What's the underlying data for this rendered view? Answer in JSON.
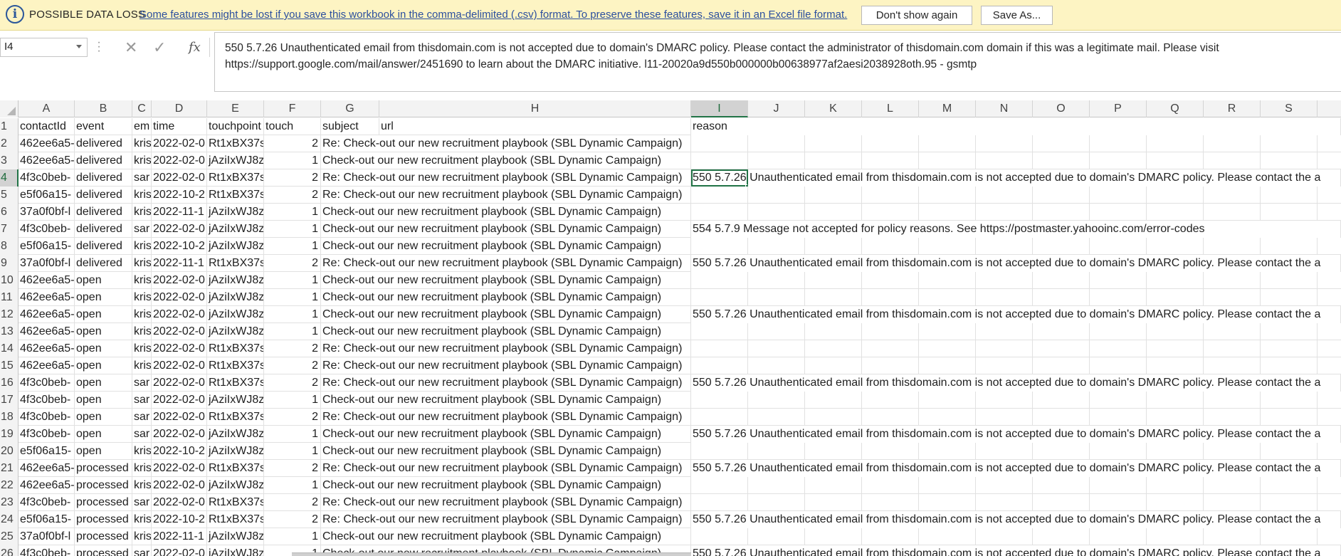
{
  "message_bar": {
    "title": "POSSIBLE DATA LOSS",
    "message": "Some features might be lost if you save this workbook in the comma-delimited (.csv) format. To preserve these features, save it in an Excel file format.",
    "dont_show_label": "Don't show again",
    "save_as_label": "Save As..."
  },
  "formula_bar": {
    "name_box": "I4",
    "cancel_glyph": "✕",
    "enter_glyph": "✓",
    "fx_label": "fx",
    "content": "550 5.7.26 Unauthenticated email from thisdomain.com is not accepted due to domain's DMARC policy. Please contact the administrator of thisdomain.com domain if this was a legitimate mail. Please visit https://support.google.com/mail/answer/2451690 to learn about the DMARC initiative. l11-20020a9d550b000000b00638977af2aesi2038928oth.95 - gsmtp"
  },
  "columns": [
    "A",
    "B",
    "C",
    "D",
    "E",
    "F",
    "G",
    "H",
    "I",
    "J",
    "K",
    "L",
    "M",
    "N",
    "O",
    "P",
    "Q",
    "R",
    "S"
  ],
  "active_column": "I",
  "active_row": "4",
  "header_row": {
    "num": "1",
    "contactId": "contactId",
    "event": "event",
    "email": "em",
    "time": "time",
    "touchpoint": "touchpoint",
    "touch": "touch",
    "subject": "subject",
    "url": "url",
    "reason": "reason"
  },
  "rows": [
    {
      "num": "2",
      "contactId": "462ee6a5-",
      "event": "delivered",
      "email": "kris",
      "time": "2022-02-0",
      "touchpoint": "Rt1xBX37s",
      "touch": "2",
      "subject": "Re: Check-out our new recruitment playbook (SBL Dynamic Campaign)",
      "reason": ""
    },
    {
      "num": "3",
      "contactId": "462ee6a5-",
      "event": "delivered",
      "email": "kris",
      "time": "2022-02-0",
      "touchpoint": "jAziIxWJ8z",
      "touch": "1",
      "subject": "Check-out our new recruitment playbook (SBL Dynamic Campaign)",
      "reason": ""
    },
    {
      "num": "4",
      "contactId": "4f3c0beb-",
      "event": "delivered",
      "email": "sar",
      "time": "2022-02-0",
      "touchpoint": "Rt1xBX37s",
      "touch": "2",
      "subject": "Re: Check-out our new recruitment playbook (SBL Dynamic Campaign)",
      "reason": "550 5.7.26 Unauthenticated email from thisdomain.com is not accepted due to domain's DMARC policy. Please contact the a"
    },
    {
      "num": "5",
      "contactId": "e5f06a15-",
      "event": "delivered",
      "email": "kris",
      "time": "2022-10-2",
      "touchpoint": "Rt1xBX37s",
      "touch": "2",
      "subject": "Re: Check-out our new recruitment playbook (SBL Dynamic Campaign)",
      "reason": ""
    },
    {
      "num": "6",
      "contactId": "37a0f0bf-l",
      "event": "delivered",
      "email": "kris",
      "time": "2022-11-1",
      "touchpoint": "jAziIxWJ8z",
      "touch": "1",
      "subject": "Check-out our new recruitment playbook (SBL Dynamic Campaign)",
      "reason": ""
    },
    {
      "num": "7",
      "contactId": "4f3c0beb-",
      "event": "delivered",
      "email": "sar",
      "time": "2022-02-0",
      "touchpoint": "jAziIxWJ8z",
      "touch": "1",
      "subject": "Check-out our new recruitment playbook (SBL Dynamic Campaign)",
      "reason": "554 5.7.9 Message not accepted for policy reasons. See https://postmaster.yahooinc.com/error-codes"
    },
    {
      "num": "8",
      "contactId": "e5f06a15-",
      "event": "delivered",
      "email": "kris",
      "time": "2022-10-2",
      "touchpoint": "jAziIxWJ8z",
      "touch": "1",
      "subject": "Check-out our new recruitment playbook (SBL Dynamic Campaign)",
      "reason": ""
    },
    {
      "num": "9",
      "contactId": "37a0f0bf-l",
      "event": "delivered",
      "email": "kris",
      "time": "2022-11-1",
      "touchpoint": "Rt1xBX37s",
      "touch": "2",
      "subject": "Re: Check-out our new recruitment playbook (SBL Dynamic Campaign)",
      "reason": "550 5.7.26 Unauthenticated email from thisdomain.com is not accepted due to domain's DMARC policy. Please contact the a"
    },
    {
      "num": "10",
      "contactId": "462ee6a5-",
      "event": "open",
      "email": "kris",
      "time": "2022-02-0",
      "touchpoint": "jAziIxWJ8z",
      "touch": "1",
      "subject": "Check-out our new recruitment playbook (SBL Dynamic Campaign)",
      "reason": ""
    },
    {
      "num": "11",
      "contactId": "462ee6a5-",
      "event": "open",
      "email": "kris",
      "time": "2022-02-0",
      "touchpoint": "jAziIxWJ8z",
      "touch": "1",
      "subject": "Check-out our new recruitment playbook (SBL Dynamic Campaign)",
      "reason": ""
    },
    {
      "num": "12",
      "contactId": "462ee6a5-",
      "event": "open",
      "email": "kris",
      "time": "2022-02-0",
      "touchpoint": "jAziIxWJ8z",
      "touch": "1",
      "subject": "Check-out our new recruitment playbook (SBL Dynamic Campaign)",
      "reason": "550 5.7.26 Unauthenticated email from thisdomain.com is not accepted due to domain's DMARC policy. Please contact the a"
    },
    {
      "num": "13",
      "contactId": "462ee6a5-",
      "event": "open",
      "email": "kris",
      "time": "2022-02-0",
      "touchpoint": "jAziIxWJ8z",
      "touch": "1",
      "subject": "Check-out our new recruitment playbook (SBL Dynamic Campaign)",
      "reason": ""
    },
    {
      "num": "14",
      "contactId": "462ee6a5-",
      "event": "open",
      "email": "kris",
      "time": "2022-02-0",
      "touchpoint": "Rt1xBX37s",
      "touch": "2",
      "subject": "Re: Check-out our new recruitment playbook (SBL Dynamic Campaign)",
      "reason": ""
    },
    {
      "num": "15",
      "contactId": "462ee6a5-",
      "event": "open",
      "email": "kris",
      "time": "2022-02-0",
      "touchpoint": "Rt1xBX37s",
      "touch": "2",
      "subject": "Re: Check-out our new recruitment playbook (SBL Dynamic Campaign)",
      "reason": ""
    },
    {
      "num": "16",
      "contactId": "4f3c0beb-",
      "event": "open",
      "email": "sar",
      "time": "2022-02-0",
      "touchpoint": "Rt1xBX37s",
      "touch": "2",
      "subject": "Re: Check-out our new recruitment playbook (SBL Dynamic Campaign)",
      "reason": "550 5.7.26 Unauthenticated email from thisdomain.com is not accepted due to domain's DMARC policy. Please contact the a"
    },
    {
      "num": "17",
      "contactId": "4f3c0beb-",
      "event": "open",
      "email": "sar",
      "time": "2022-02-0",
      "touchpoint": "jAziIxWJ8z",
      "touch": "1",
      "subject": "Check-out our new recruitment playbook (SBL Dynamic Campaign)",
      "reason": ""
    },
    {
      "num": "18",
      "contactId": "4f3c0beb-",
      "event": "open",
      "email": "sar",
      "time": "2022-02-0",
      "touchpoint": "Rt1xBX37s",
      "touch": "2",
      "subject": "Re: Check-out our new recruitment playbook (SBL Dynamic Campaign)",
      "reason": ""
    },
    {
      "num": "19",
      "contactId": "4f3c0beb-",
      "event": "open",
      "email": "sar",
      "time": "2022-02-0",
      "touchpoint": "jAziIxWJ8z",
      "touch": "1",
      "subject": "Check-out our new recruitment playbook (SBL Dynamic Campaign)",
      "reason": "550 5.7.26 Unauthenticated email from thisdomain.com is not accepted due to domain's DMARC policy. Please contact the a"
    },
    {
      "num": "20",
      "contactId": "e5f06a15-",
      "event": "open",
      "email": "kris",
      "time": "2022-10-2",
      "touchpoint": "jAziIxWJ8z",
      "touch": "1",
      "subject": "Check-out our new recruitment playbook (SBL Dynamic Campaign)",
      "reason": ""
    },
    {
      "num": "21",
      "contactId": "462ee6a5-",
      "event": "processed",
      "email": "kris",
      "time": "2022-02-0",
      "touchpoint": "Rt1xBX37s",
      "touch": "2",
      "subject": "Re: Check-out our new recruitment playbook (SBL Dynamic Campaign)",
      "reason": "550 5.7.26 Unauthenticated email from thisdomain.com is not accepted due to domain's DMARC policy. Please contact the a"
    },
    {
      "num": "22",
      "contactId": "462ee6a5-",
      "event": "processed",
      "email": "kris",
      "time": "2022-02-0",
      "touchpoint": "jAziIxWJ8z",
      "touch": "1",
      "subject": "Check-out our new recruitment playbook (SBL Dynamic Campaign)",
      "reason": ""
    },
    {
      "num": "23",
      "contactId": "4f3c0beb-",
      "event": "processed",
      "email": "sar",
      "time": "2022-02-0",
      "touchpoint": "Rt1xBX37s",
      "touch": "2",
      "subject": "Re: Check-out our new recruitment playbook (SBL Dynamic Campaign)",
      "reason": ""
    },
    {
      "num": "24",
      "contactId": "e5f06a15-",
      "event": "processed",
      "email": "kris",
      "time": "2022-10-2",
      "touchpoint": "Rt1xBX37s",
      "touch": "2",
      "subject": "Re: Check-out our new recruitment playbook (SBL Dynamic Campaign)",
      "reason": "550 5.7.26 Unauthenticated email from thisdomain.com is not accepted due to domain's DMARC policy. Please contact the a"
    },
    {
      "num": "25",
      "contactId": "37a0f0bf-l",
      "event": "processed",
      "email": "kris",
      "time": "2022-11-1",
      "touchpoint": "jAziIxWJ8z",
      "touch": "1",
      "subject": "Check-out our new recruitment playbook (SBL Dynamic Campaign)",
      "reason": ""
    },
    {
      "num": "26",
      "contactId": "4f3c0beb-",
      "event": "processed",
      "email": "sar",
      "time": "2022-02-0",
      "touchpoint": "jAziIxWJ8z",
      "touch": "1",
      "subject": "Check-out our new recruitment playbook (SBL Dynamic Campaign)",
      "reason": "550 5.7.26 Unauthenticated email from thisdomain.com is not accepted due to domain's DMARC policy. Please contact the a"
    }
  ]
}
